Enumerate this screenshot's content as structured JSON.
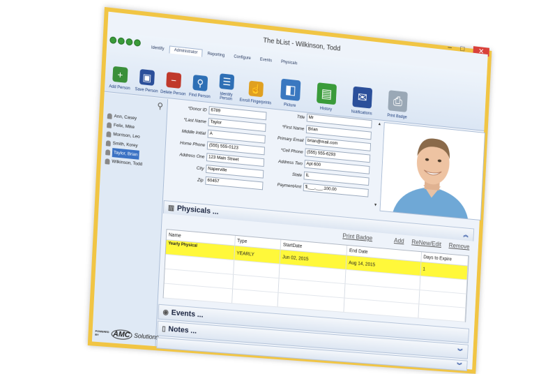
{
  "window": {
    "title": "The bList - Wilkinson, Todd",
    "controls": [
      "–",
      "□",
      "✕"
    ]
  },
  "ribbon": {
    "tabs": [
      "Identify",
      "Administrator",
      "Reporting",
      "Configure",
      "Events",
      "Physicals"
    ],
    "active_tab": "Administrator",
    "tools": [
      {
        "label": "Add Person",
        "icon": "add-person-icon",
        "color": "#3a8f3a"
      },
      {
        "label": "Save Person",
        "icon": "save-person-icon",
        "color": "#2b4f9a"
      },
      {
        "label": "Delete Person",
        "icon": "delete-person-icon",
        "color": "#c0392b"
      },
      {
        "label": "Find Person",
        "icon": "find-person-icon",
        "color": "#2e6fb5"
      },
      {
        "label": "Identify Person",
        "icon": "identify-person-icon",
        "color": "#2e6fb5"
      },
      {
        "label": "Enroll Fingerprints",
        "icon": "fingerprint-icon",
        "color": "#e0a020"
      }
    ],
    "big_tools": [
      {
        "label": "Picture",
        "icon": "picture-icon",
        "color": "#3a78c0"
      },
      {
        "label": "History",
        "icon": "history-icon",
        "color": "#3a9b3a"
      },
      {
        "label": "Notifications",
        "icon": "notifications-icon",
        "color": "#2b4f9a"
      },
      {
        "label": "Print Badge",
        "icon": "print-badge-icon",
        "color": "#6a7a8a"
      }
    ]
  },
  "people": [
    {
      "name": "Ann, Casey",
      "selected": false
    },
    {
      "name": "Felix, Mike",
      "selected": false
    },
    {
      "name": "Morrison, Leo",
      "selected": false
    },
    {
      "name": "Smith, Korey",
      "selected": false
    },
    {
      "name": "Taylor, Brian",
      "selected": true
    },
    {
      "name": "Wilkinson, Todd",
      "selected": false
    }
  ],
  "branding": {
    "powered_by": "POWERED BY",
    "mark": "AMC",
    "name": "Solutions"
  },
  "form_left": [
    {
      "label": "*Donor ID",
      "value": "6789"
    },
    {
      "label": "*Last Name",
      "value": "Taylor"
    },
    {
      "label": "Middle Initial",
      "value": "A"
    },
    {
      "label": "Home Phone",
      "value": "(555) 555-0123"
    },
    {
      "label": "Address One",
      "value": "123 Main Street"
    },
    {
      "label": "City",
      "value": "Naperville"
    },
    {
      "label": "Zip",
      "value": "60457"
    }
  ],
  "form_right": [
    {
      "label": "Title",
      "value": "Mr"
    },
    {
      "label": "*First Name",
      "value": "Brian"
    },
    {
      "label": "Primary Email",
      "value": "brian@mail.com"
    },
    {
      "label": "*Cell Phone",
      "value": "(555) 555-6293"
    },
    {
      "label": "Address Two",
      "value": "Apt 600"
    },
    {
      "label": "State",
      "value": "IL"
    },
    {
      "label": "PaymentAmt",
      "value": "$___,___.100.00"
    }
  ],
  "physicals": {
    "title": "Physicals ...",
    "actions": [
      "Print Badge",
      "Add",
      "ReNew/Edit",
      "Remove"
    ],
    "columns": [
      "Name",
      "Type",
      "StartDate",
      "End Date",
      "Days to Expire"
    ],
    "rows": [
      [
        "Yearly Physical",
        "YEARLY",
        "Jun 02, 2015",
        "Aug 14, 2015",
        "1"
      ]
    ]
  },
  "events": {
    "title": "Events ..."
  },
  "notes": {
    "title": "Notes ..."
  },
  "colors": {
    "frame": "#f1c544",
    "highlight": "#fff83a",
    "selection": "#3b72c4"
  }
}
